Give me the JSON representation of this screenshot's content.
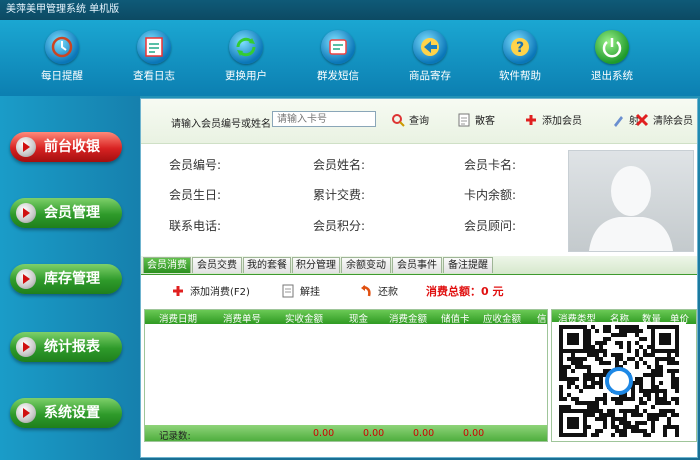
{
  "window": {
    "title": "美萍美甲管理系统 单机版"
  },
  "toolbar": {
    "items": [
      {
        "label": "每日提醒",
        "icon": "alarm-icon"
      },
      {
        "label": "查看日志",
        "icon": "log-icon"
      },
      {
        "label": "更换用户",
        "icon": "switch-user-icon"
      },
      {
        "label": "群发短信",
        "icon": "sms-icon"
      },
      {
        "label": "商品寄存",
        "icon": "storage-icon"
      },
      {
        "label": "软件帮助",
        "icon": "help-icon"
      },
      {
        "label": "退出系统",
        "icon": "power-icon"
      }
    ]
  },
  "sidebar": {
    "items": [
      {
        "label": "前台收银"
      },
      {
        "label": "会员管理"
      },
      {
        "label": "库存管理"
      },
      {
        "label": "统计报表"
      },
      {
        "label": "系统设置"
      }
    ]
  },
  "search": {
    "label": "请输入会员编号或姓名:",
    "placeholder": "请输入卡号",
    "query": "查询",
    "walkin": "散客",
    "add_member": "添加会员",
    "partial": "射",
    "clear_member": "清除会员"
  },
  "member": {
    "id_label": "会员编号:",
    "name_label": "会员姓名:",
    "card_label": "会员卡名:",
    "birthday_label": "会员生日:",
    "total_label": "累计交费:",
    "balance_label": "卡内余额:",
    "phone_label": "联系电话:",
    "points_label": "会员积分:",
    "advisor_label": "会员顾问:"
  },
  "tabs": [
    "会员消费",
    "会员交费",
    "我的套餐",
    "积分管理",
    "余额变动",
    "会员事件",
    "备注提醒"
  ],
  "actions": {
    "add_consume": "添加消费(F2)",
    "suspend": "解挂",
    "refund": "还款",
    "total_label": "消费总额：",
    "total_value": "0 元"
  },
  "grid": {
    "columns": [
      "消费日期",
      "消费单号",
      "实收金额",
      "现金",
      "消费金额",
      "储值卡",
      "应收金额",
      "信"
    ],
    "footer_label": "记录数:",
    "footer_values": [
      "0.00",
      "0.00",
      "0.00",
      "0.00"
    ]
  },
  "subgrid": {
    "columns": [
      "消费类型",
      "名称",
      "数量",
      "单价"
    ]
  },
  "colors": {
    "accent_green": "#2f9a22",
    "accent_red": "#d82222",
    "toolbar_blue": "#0c7fb1"
  }
}
